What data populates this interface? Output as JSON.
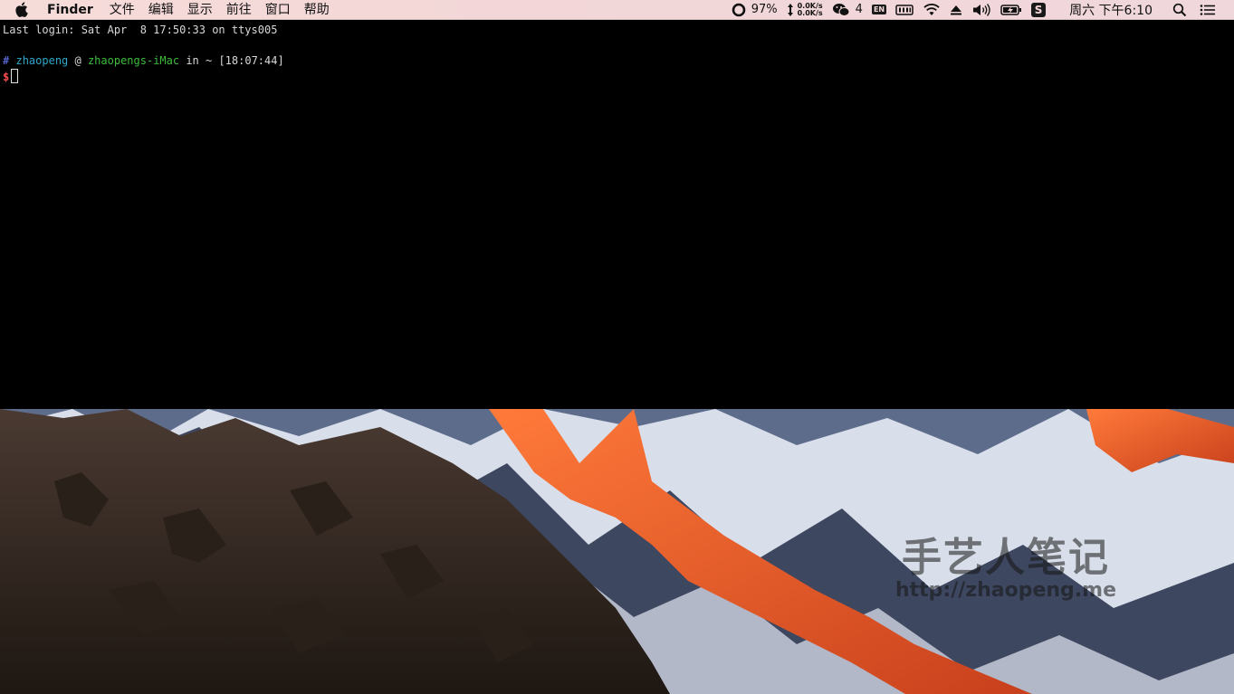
{
  "menubar": {
    "app_name": "Finder",
    "menus": [
      "文件",
      "编辑",
      "显示",
      "前往",
      "窗口",
      "帮助"
    ],
    "battery_percent": "97%",
    "net_up": "0.0K/s",
    "net_down": "0.0K/s",
    "wechat_count": "4",
    "input_source": "EN",
    "sogou": "S",
    "clock": "周六 下午6:10"
  },
  "terminal": {
    "last_login": "Last login: Sat Apr  8 17:50:33 on ttys005",
    "prompt_hash": "#",
    "prompt_user": "zhaopeng",
    "prompt_at": " @ ",
    "prompt_host": "zhaopengs-iMac",
    "prompt_in": " in ~ [18:07:44]",
    "prompt_dollar": "$"
  },
  "watermark": {
    "title": "手艺人笔记",
    "url": "http://zhaopeng.me"
  },
  "colors": {
    "menubar_bg": "#f4d9d8",
    "terminal_bg": "#000000",
    "user": "#2fa7c9",
    "host": "#3cbd3c",
    "dollar": "#ff4d4d",
    "hash": "#6b7cff"
  }
}
